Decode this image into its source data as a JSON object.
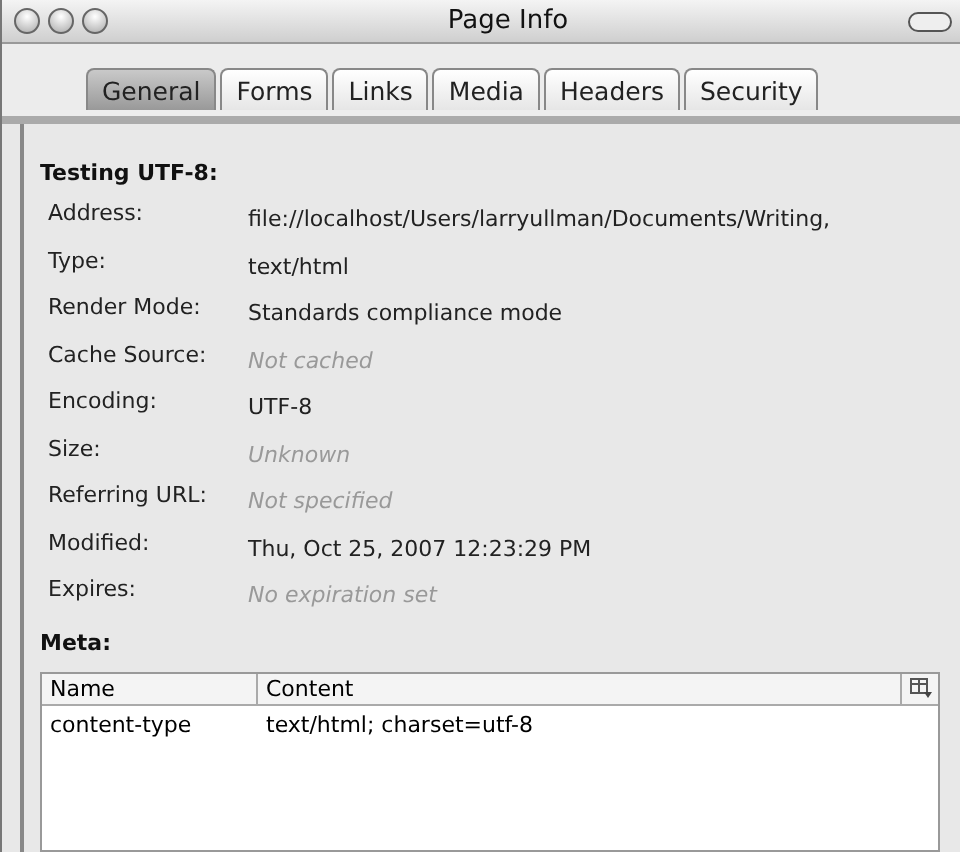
{
  "window": {
    "title": "Page Info"
  },
  "tabs": [
    {
      "label": "General",
      "selected": true
    },
    {
      "label": "Forms",
      "selected": false
    },
    {
      "label": "Links",
      "selected": false
    },
    {
      "label": "Media",
      "selected": false
    },
    {
      "label": "Headers",
      "selected": false
    },
    {
      "label": "Security",
      "selected": false
    }
  ],
  "heading": "Testing UTF-8:",
  "fields": [
    {
      "label": "Address:",
      "value": "file://localhost/Users/larryullman/Documents/Writing,",
      "kind": "known"
    },
    {
      "label": "Type:",
      "value": "text/html",
      "kind": "known"
    },
    {
      "label": "Render Mode:",
      "value": "Standards compliance mode",
      "kind": "known"
    },
    {
      "label": "Cache Source:",
      "value": "Not cached",
      "kind": "unknown"
    },
    {
      "label": "Encoding:",
      "value": "UTF-8",
      "kind": "known"
    },
    {
      "label": "Size:",
      "value": "Unknown",
      "kind": "unknown"
    },
    {
      "label": "Referring URL:",
      "value": "Not specified",
      "kind": "unknown"
    },
    {
      "label": "Modified:",
      "value": "Thu, Oct 25, 2007 12:23:29 PM",
      "kind": "known"
    },
    {
      "label": "Expires:",
      "value": "No expiration set",
      "kind": "unknown"
    }
  ],
  "meta": {
    "heading": "Meta:",
    "columns": [
      "Name",
      "Content"
    ],
    "rows": [
      [
        "content-type",
        "text/html; charset=utf-8"
      ]
    ]
  }
}
